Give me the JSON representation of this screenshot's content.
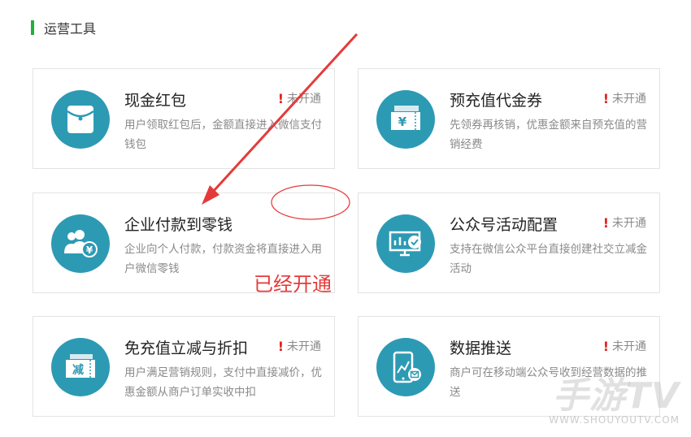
{
  "section": {
    "title": "运营工具"
  },
  "status_label": "未开通",
  "cards": [
    {
      "title": "现金红包",
      "desc": "用户领取红包后，金额直接进入微信支付钱包",
      "status": "未开通",
      "icon": "envelope-icon"
    },
    {
      "title": "预充值代金券",
      "desc": "先领券再核销，优惠金额来自预充值的营销经费",
      "status": "未开通",
      "icon": "yen-voucher-icon"
    },
    {
      "title": "企业付款到零钱",
      "desc": "企业向个人付款，付款资金将直接进入用户微信零钱",
      "icon": "users-yen-icon"
    },
    {
      "title": "公众号活动配置",
      "desc": "支持在微信公众平台直接创建社交立减金活动",
      "status": "未开通",
      "icon": "monitor-badge-icon"
    },
    {
      "title": "免充值立减与折扣",
      "desc": "用户满足营销规则，支付中直接减价，优惠金额从商户订单实收中扣",
      "status": "未开通",
      "icon": "discount-voucher-icon",
      "icon_text": "减"
    },
    {
      "title": "数据推送",
      "desc": "商户可在移动端公众号收到经营数据的推送",
      "status": "未开通",
      "icon": "phone-chart-icon"
    }
  ],
  "annotation": {
    "text": "已经开通",
    "color": "#e53a3a"
  },
  "watermark": {
    "logo": "手游TV",
    "url": "WWW.SHOUYOUTV.COM"
  },
  "colors": {
    "accent_green": "#1fb13a",
    "icon_bg": "#2d9ab4",
    "warning_red": "#e02424"
  }
}
